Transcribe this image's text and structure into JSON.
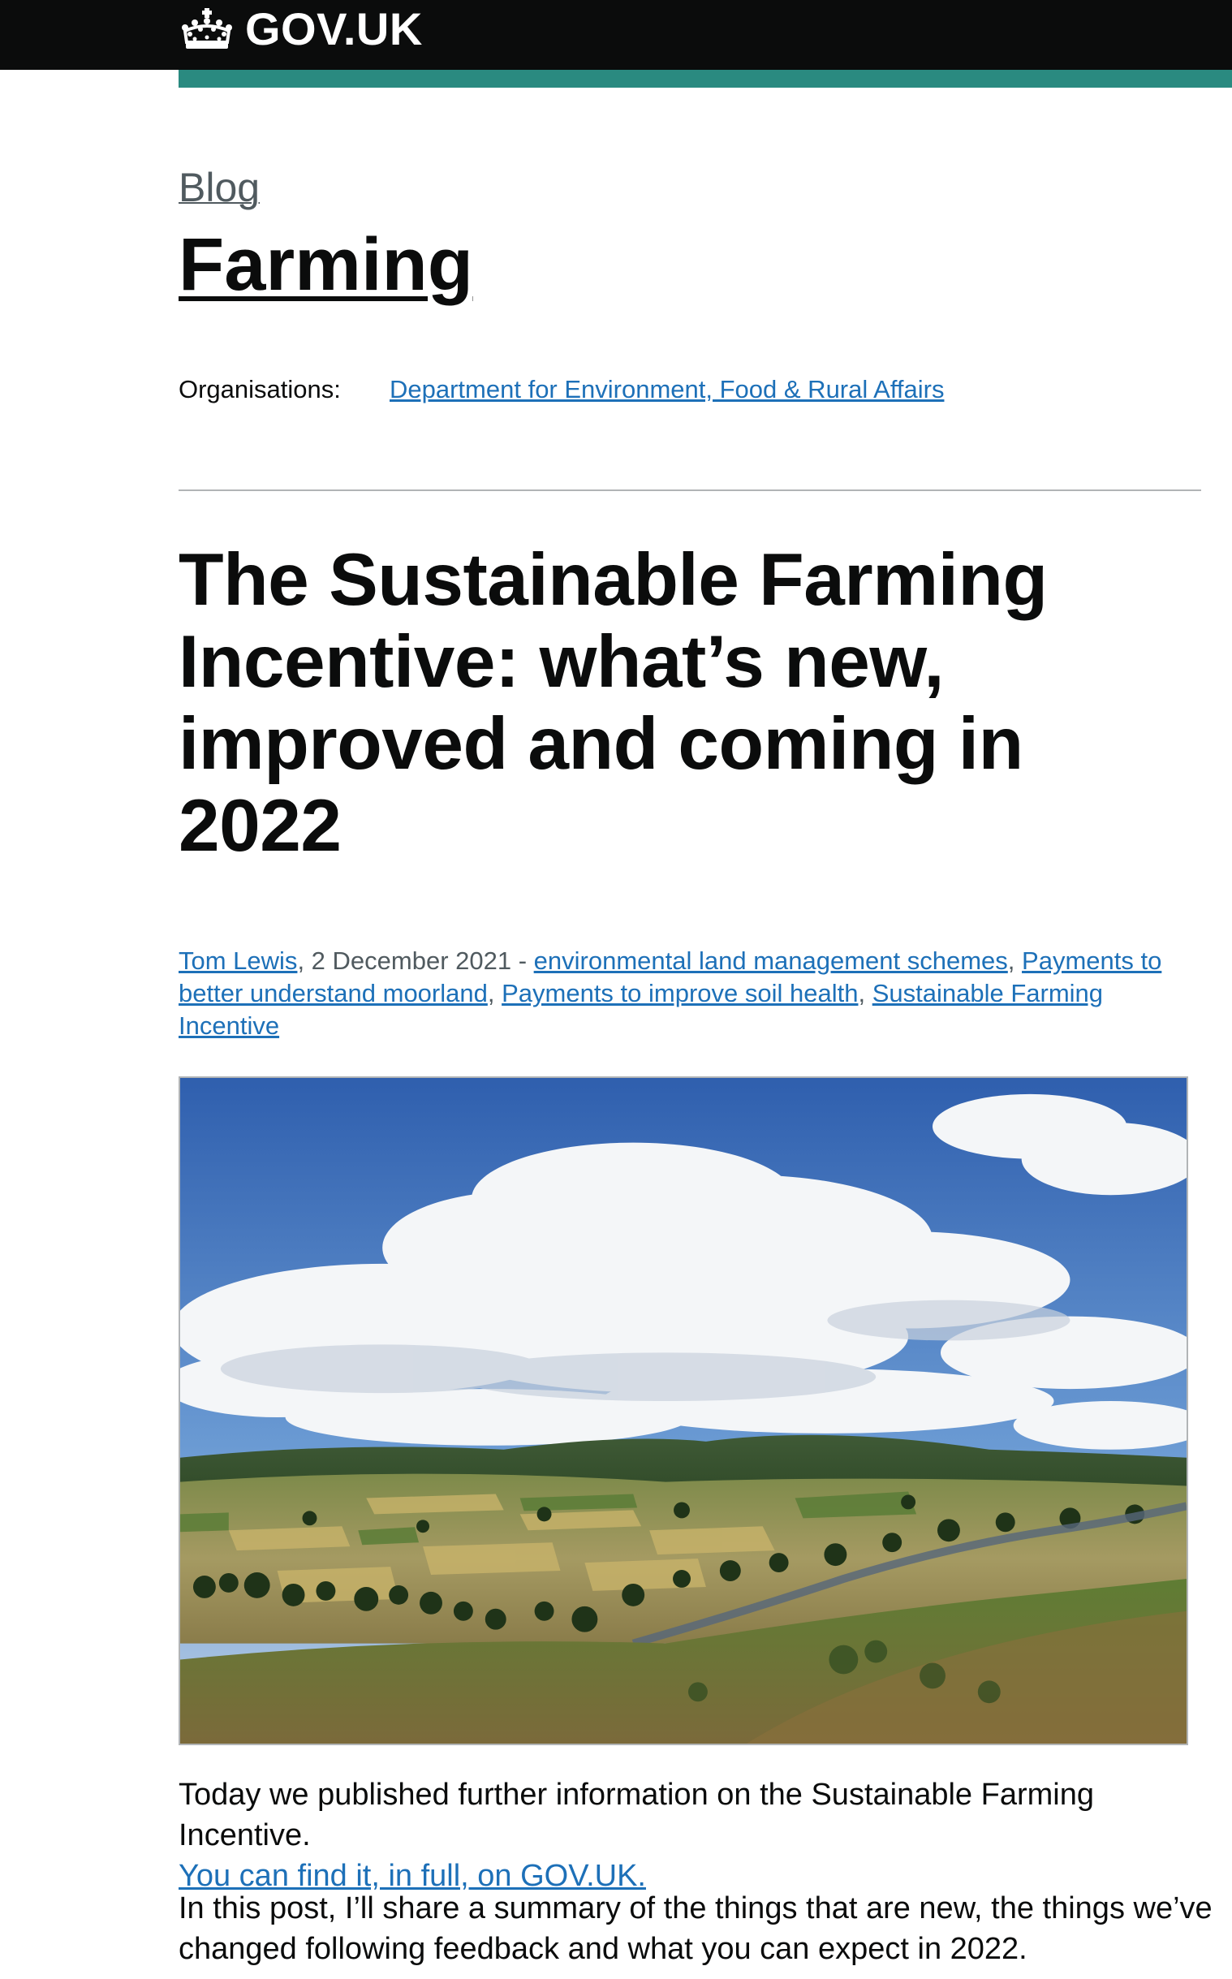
{
  "header": {
    "logo_text": "GOV.UK",
    "accent_color": "#2a8a80"
  },
  "blog": {
    "breadcrumb": "Blog",
    "title": "Farming",
    "organisations_label": "Organisations:",
    "organisation_link": "Department for Environment, Food & Rural Affairs"
  },
  "article": {
    "title": "The Sustainable Farming Incentive: what’s new, improved and coming in 2022",
    "author": "Tom Lewis",
    "date": ", 2 December 2021 - ",
    "tags": [
      "environmental land management schemes",
      "Payments to better understand moorland",
      "Payments to improve soil health",
      "Sustainable Farming Incentive"
    ],
    "tag_separator": ", ",
    "paragraph1_text": "Today we published further information on the Sustainable Farming Incentive.",
    "paragraph1_link": "You can find it, in full, on GOV.UK.",
    "paragraph2": "In this post, I’ll share a summary of the things that are new, the things we’ve changed following feedback and what you can expect in 2022."
  }
}
